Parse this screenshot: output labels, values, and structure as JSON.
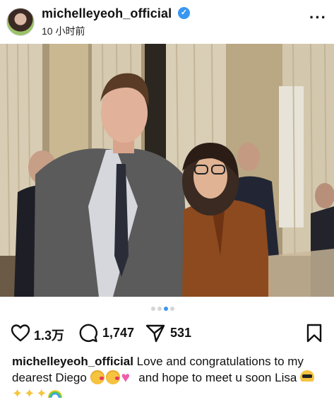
{
  "post": {
    "username": "michelleyeoh_official",
    "verified": true,
    "time": "10 小时前",
    "more_icon": "more-horizontal-icon"
  },
  "carousel": {
    "total": 4,
    "active_index": 2
  },
  "actions": {
    "like_count": "1.3万",
    "comment_count": "1,747",
    "share_count": "531"
  },
  "caption": {
    "username": "michelleyeoh_official",
    "text_1": " Love and congratulations to my dearest Diego ",
    "text_2": " and hope to meet u soon Lisa "
  },
  "colors": {
    "verified": "#3897f0",
    "active_dot": "#3897f0"
  }
}
